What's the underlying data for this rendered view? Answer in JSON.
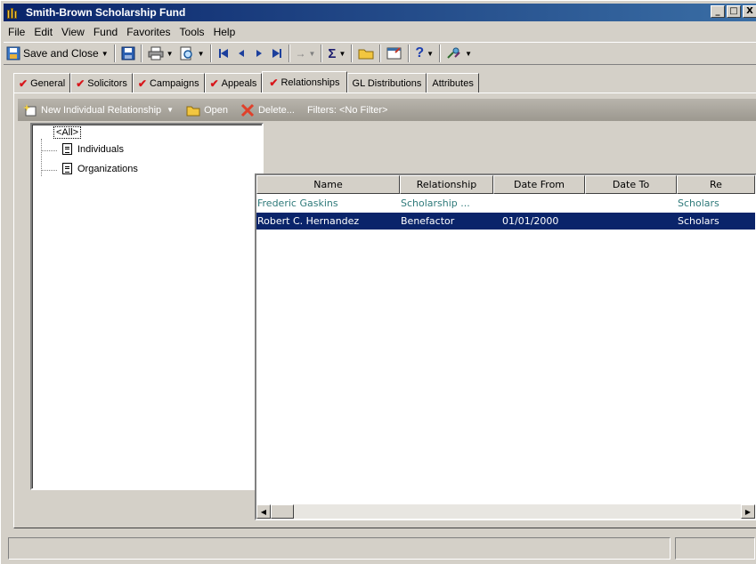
{
  "window": {
    "title": "Smith-Brown Scholarship Fund",
    "minimize": "_",
    "maximize": "□",
    "close": "X"
  },
  "menu": [
    "File",
    "Edit",
    "View",
    "Fund",
    "Favorites",
    "Tools",
    "Help"
  ],
  "toolbar": {
    "save_and_close": "Save and Close",
    "arrow_glyph": "→",
    "sigma_glyph": "Σ",
    "help_glyph": "?"
  },
  "tabs": [
    {
      "label": "General",
      "checked": true
    },
    {
      "label": "Solicitors",
      "checked": true
    },
    {
      "label": "Campaigns",
      "checked": true
    },
    {
      "label": "Appeals",
      "checked": true
    },
    {
      "label": "Relationships",
      "checked": true,
      "active": true
    },
    {
      "label": "GL Distributions",
      "checked": false
    },
    {
      "label": "Attributes",
      "checked": false
    }
  ],
  "actionbar": {
    "new_relationship": "New Individual Relationship",
    "open": "Open",
    "delete": "Delete...",
    "filters": "Filters: <No Filter>"
  },
  "tree": {
    "root": "<All>",
    "items": [
      "Individuals",
      "Organizations"
    ]
  },
  "grid": {
    "columns": [
      "Name",
      "Relationship",
      "Date From",
      "Date To",
      "Re"
    ],
    "rows": [
      {
        "name": "Frederic Gaskins",
        "relationship": "Scholarship ...",
        "date_from": "",
        "date_to": "",
        "reciprocal": "Scholars"
      },
      {
        "name": "Robert C. Hernandez",
        "relationship": "Benefactor",
        "date_from": "01/01/2000",
        "date_to": "",
        "reciprocal": "Scholars"
      }
    ]
  },
  "colors": {
    "titlebar_start": "#0a246a",
    "titlebar_end": "#3a6ea5",
    "selection": "#0a246a",
    "link_text": "#2f7a7a",
    "check": "#d8161b"
  }
}
